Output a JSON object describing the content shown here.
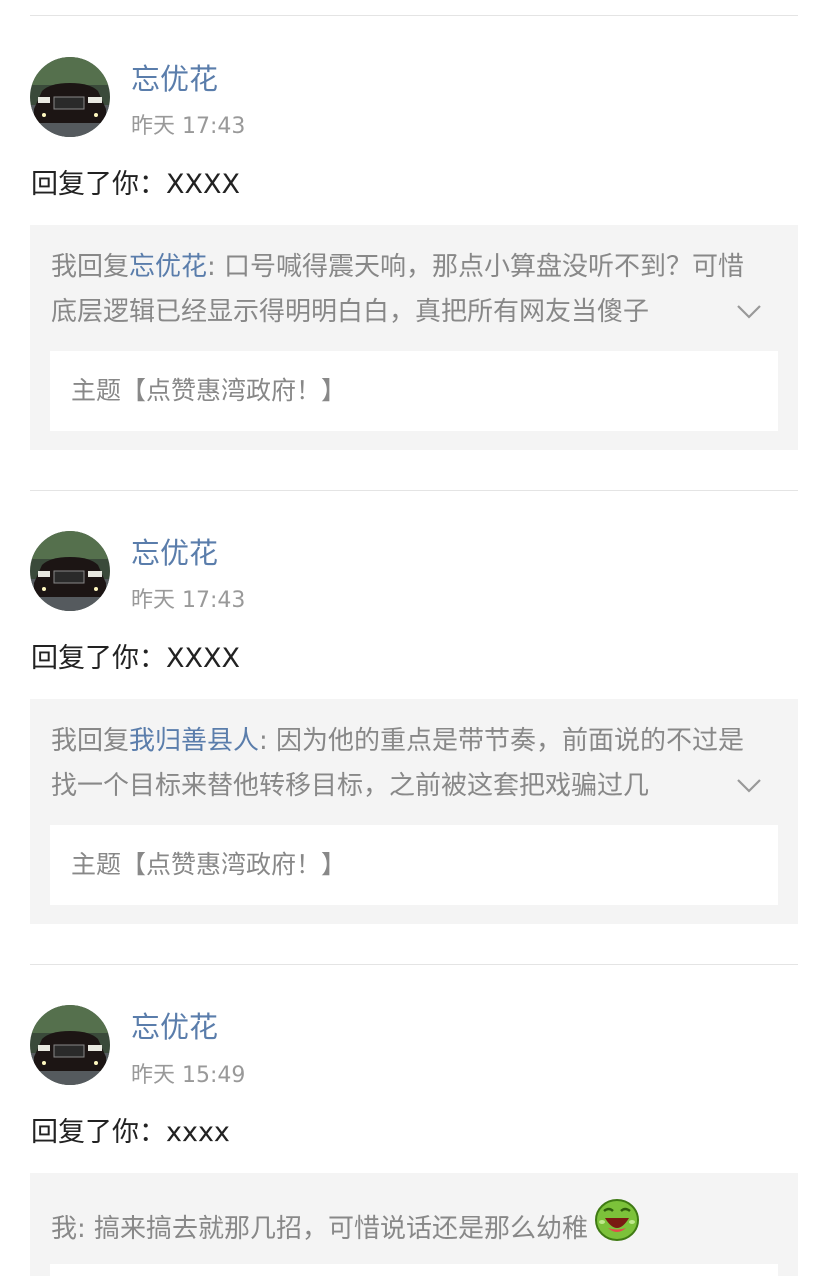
{
  "items": [
    {
      "user": "忘优花",
      "time": "昨天 17:43",
      "reply": "回复了你：XXXX",
      "quote_prefix": "我回复",
      "quote_mention": "忘优花",
      "quote_body": ": 口号喊得震天响，那点小算盘没听不到？可惜底层逻辑已经显示得明明白白，真把所有网友当傻子",
      "topic": "主题【点赞惠湾政府！】"
    },
    {
      "user": "忘优花",
      "time": "昨天 17:43",
      "reply": "回复了你：XXXX",
      "quote_prefix": "我回复",
      "quote_mention": "我归善县人",
      "quote_body": ": 因为他的重点是带节奏，前面说的不过是找一个目标来替他转移目标，之前被这套把戏骗过几",
      "topic": "主题【点赞惠湾政府！】"
    },
    {
      "user": "忘优花",
      "time": "昨天 15:49",
      "reply": "回复了你：xxxx",
      "quote_prefix": "我",
      "quote_body": ": 搞来搞去就那几招，可惜说话还是那么幼稚"
    }
  ],
  "icons": {
    "expand": "chevron-down-icon",
    "emoji": "laughing-emoji-icon",
    "avatar": "car-photo-avatar"
  },
  "colors": {
    "link": "#5a7dab",
    "muted": "#888888",
    "quote_bg": "#f4f4f4",
    "divider": "#e4e4e4"
  }
}
